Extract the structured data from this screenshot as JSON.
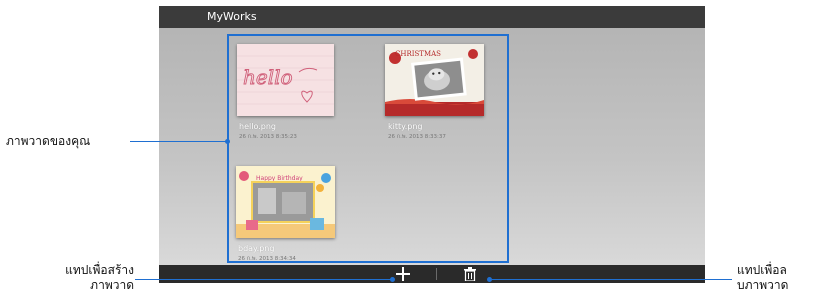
{
  "app": {
    "title": "MyWorks"
  },
  "works": [
    {
      "file": "hello.png",
      "date": "26 ก.พ. 2013 8:35:23",
      "preview_text": "hello",
      "icon": "heart-doodle"
    },
    {
      "file": "kitty.png",
      "date": "26 ก.พ. 2013 8:33:37",
      "preview_text": "CHRISTMAS",
      "icon": "kitten-photo"
    },
    {
      "file": "bday.png",
      "date": "26 ก.พ. 2013 8:34:34",
      "preview_text": "Happy Birthday",
      "icon": "birthday-frame"
    }
  ],
  "actionbar": {
    "add_icon": "plus-icon",
    "delete_icon": "trash-icon"
  },
  "callouts": {
    "works_label": "ภาพวาดของคุณ",
    "create_label_line1": "แทปเพื่อสร้าง",
    "create_label_line2": "ภาพวาด",
    "delete_label_line1": "แทปเพื่อล",
    "delete_label_line2": "บภาพวาด"
  },
  "colors": {
    "accent": "#1f6fd1",
    "titlebar": "#3b3b3b",
    "actionbar": "#2a2a2a"
  }
}
